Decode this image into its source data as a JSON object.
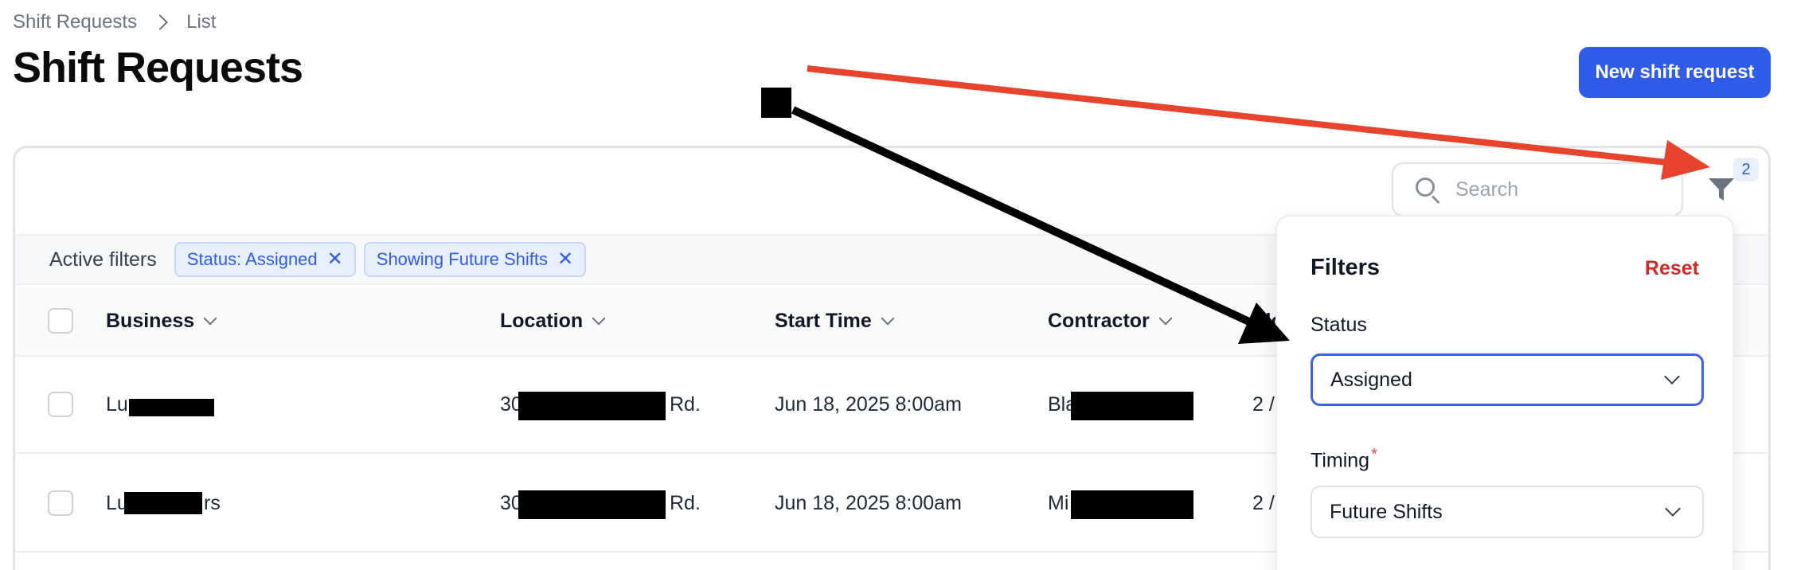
{
  "breadcrumb": {
    "items": [
      "Shift Requests",
      "List"
    ]
  },
  "page": {
    "title": "Shift Requests"
  },
  "header": {
    "new_button": "New shift request"
  },
  "search": {
    "placeholder": "Search"
  },
  "filter": {
    "badge": "2"
  },
  "active_filters": {
    "label": "Active filters",
    "chips": [
      "Status: Assigned",
      "Showing Future Shifts"
    ]
  },
  "table": {
    "columns": [
      "Business",
      "Location",
      "Start Time",
      "Contractor",
      "Slo"
    ],
    "rows": [
      {
        "business": "Lu",
        "location_prefix": "30",
        "location_suffix": "Rd.",
        "start_time": "Jun 18, 2025 8:00am",
        "contractor": "Bla",
        "slots": "2 /"
      },
      {
        "business": "Lu",
        "business_tail": "rs",
        "location_prefix": "30",
        "location_suffix": "Rd.",
        "start_time": "Jun 18, 2025 8:00am",
        "contractor": "Mi",
        "slots": "2 /"
      }
    ]
  },
  "filters_panel": {
    "title": "Filters",
    "reset": "Reset",
    "status_label": "Status",
    "status_value": "Assigned",
    "timing_label": "Timing",
    "timing_required": "*",
    "timing_value": "Future Shifts"
  },
  "colors": {
    "primary": "#2f5be8",
    "reset": "#d12a2a",
    "annotation_red": "#e8432d",
    "annotation_black": "#000000"
  }
}
